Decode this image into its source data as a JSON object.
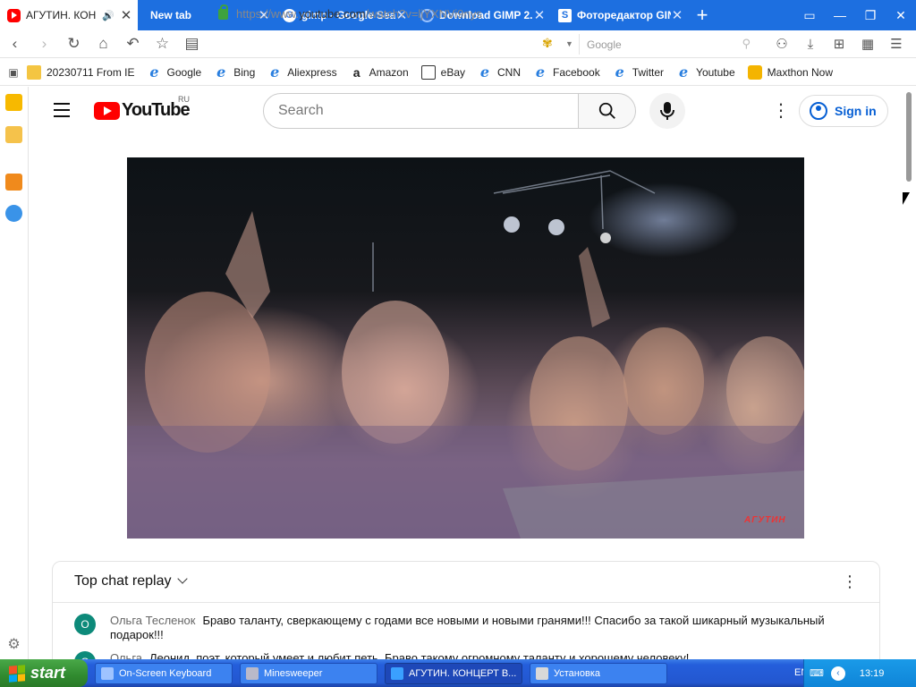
{
  "browser": {
    "tabs": [
      {
        "label": "АГУТИН. КОН",
        "active": true,
        "favicon": "youtube-icon"
      },
      {
        "label": "New tab",
        "active": false,
        "favicon": "none"
      },
      {
        "label": "gimp - Google Sear",
        "active": false,
        "favicon": "google-icon"
      },
      {
        "label": "Download GIMP 2.",
        "active": false,
        "favicon": "gimp-icon"
      },
      {
        "label": "Фоторедактор GIN",
        "active": false,
        "favicon": "site-icon"
      }
    ],
    "url_prefix": "https://www.",
    "url_host": "youtube.com",
    "url_path": "/watch?v=ljYXNVi9nys",
    "search_placeholder": "Google",
    "bookmarks": [
      {
        "label": "20230711 From IE",
        "icon": "folder-icon"
      },
      {
        "label": "Google",
        "icon": "ie-icon"
      },
      {
        "label": "Bing",
        "icon": "ie-icon"
      },
      {
        "label": "Aliexpress",
        "icon": "ie-icon"
      },
      {
        "label": "Amazon",
        "icon": "amazon-icon"
      },
      {
        "label": "eBay",
        "icon": "ebay-icon"
      },
      {
        "label": "CNN",
        "icon": "ie-icon"
      },
      {
        "label": "Facebook",
        "icon": "ie-icon"
      },
      {
        "label": "Twitter",
        "icon": "ie-icon"
      },
      {
        "label": "Youtube",
        "icon": "ie-icon"
      },
      {
        "label": "Maxthon Now",
        "icon": "maxthon-icon"
      }
    ]
  },
  "youtube": {
    "logo_text": "YouTube",
    "region": "RU",
    "search_placeholder": "Search",
    "sign_in": "Sign in",
    "video_watermark": "АГУТИН",
    "chat": {
      "title": "Top chat replay",
      "messages": [
        {
          "avatar": "О",
          "author": "Ольга Тесленок",
          "text": "Браво таланту, сверкающему с годами все новыми и новыми гранями!!! Спасибо за такой шикарный музыкальный подарок!!!"
        },
        {
          "avatar": "О",
          "author": "Ольга",
          "text": "Леонид, поэт, который умеет и любит петь. Браво такому огромному таланту и хорошему человеку!"
        }
      ]
    }
  },
  "taskbar": {
    "start": "start",
    "tasks": [
      {
        "label": "On-Screen Keyboard",
        "active": false
      },
      {
        "label": "Minesweeper",
        "active": false
      },
      {
        "label": "АГУТИН. КОНЦЕРТ В...",
        "active": true
      },
      {
        "label": "Установка",
        "active": false
      }
    ],
    "lang": "EN",
    "clock": "13:19"
  }
}
